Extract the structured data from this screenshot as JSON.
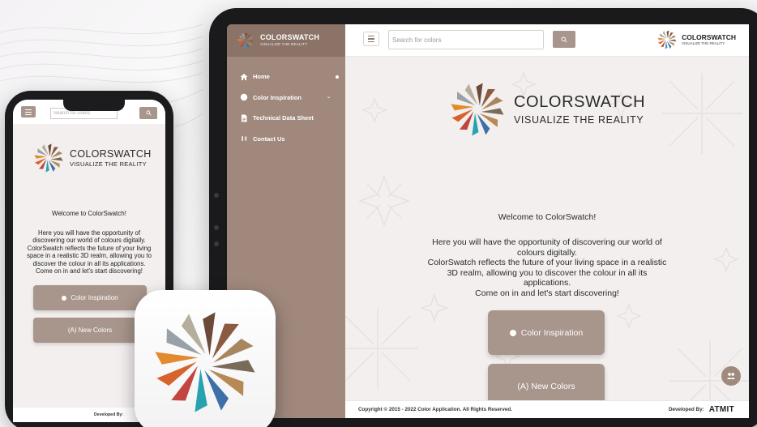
{
  "brand": {
    "name": "COLORSWATCH",
    "tagline_small": "VISUALIZE THE REALITY",
    "tagline_hero": "VISUALIZE THE REALITY"
  },
  "sidebar": {
    "items": [
      {
        "label": "Home",
        "icon": "home-icon",
        "active": true
      },
      {
        "label": "Color Inspiration",
        "icon": "circle-icon",
        "expandable": true
      },
      {
        "label": "Technical Data Sheet",
        "icon": "document-icon"
      },
      {
        "label": "Contact Us",
        "icon": "phone-contact-icon"
      }
    ]
  },
  "topbar": {
    "search_placeholder": "Search for colors",
    "search_icon": "search-icon",
    "menu_icon": "hamburger-menu-icon"
  },
  "main": {
    "welcome": "Welcome to ColorSwatch!",
    "intro_lines": [
      "Here you will have the opportunity of discovering our world of",
      "colours digitally.",
      "ColorSwatch reflects the future of your living space in a realistic",
      "3D realm, allowing you to discover the colour in all its",
      "applications.",
      "Come on in and let's start discovering!"
    ],
    "buttons": {
      "color_inspiration": "Color Inspiration",
      "new_colors": "(A) New Colors"
    }
  },
  "footer": {
    "copyright": "Copyright © 2015 - 2022 Color Application. All Rights Reserved.",
    "developed_by": "Developed By:",
    "developer_logo": "ATMIT"
  },
  "phone": {
    "search_placeholder": "Search for colors",
    "welcome": "Welcome to ColorSwatch!",
    "intro_lines": [
      "Here you will have the opportunity of",
      "discovering our world of colours digitally.",
      "ColorSwatch reflects the future of your living",
      "space in a realistic 3D realm, allowing you to",
      "discover the colour in all its applications.",
      "Come on in and let's start discovering!"
    ],
    "btn_color_inspiration": "Color Inspiration",
    "btn_new_colors": "(A) New Colors",
    "developed_by": "Developed By:"
  },
  "colors": {
    "accent": "#a8958c",
    "sidebar": "#a0887c",
    "sidebar_header": "#8b7368",
    "background": "#f3efee"
  }
}
